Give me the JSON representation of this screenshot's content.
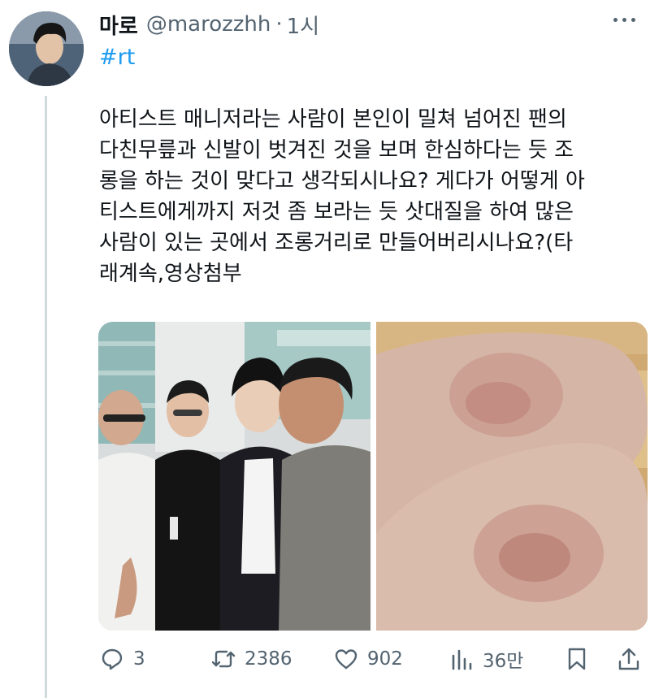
{
  "author": {
    "display_name": "마로",
    "handle": "@marozzhh",
    "separator": "·",
    "time": "1시"
  },
  "hashtag": "#rt",
  "tweet_text": "아티스트 매니저라는 사람이 본인이 밀쳐 넘어진 팬의\n다친무릎과 신발이 벗겨진 것을 보며 한심하다는 듯 조\n롱을 하는 것이 맞다고 생각되시나요? 게다가 어떻게 아\n티스트에게까지 저것 좀 보라는 듯 삿대질을 하여 많은\n사람이 있는 곳에서 조롱거리로 만들어버리시나요?(타\n래계속,영상첨부",
  "media": [
    {
      "icon": "photo-people-airport"
    },
    {
      "icon": "photo-bruised-knees"
    }
  ],
  "actions": {
    "replies": "3",
    "retweets": "2386",
    "likes": "902",
    "views": "36만"
  },
  "colors": {
    "accent": "#1d9bf0",
    "secondary_text": "#536471",
    "primary_text": "#0f1419",
    "thread_line": "#cfd9de"
  }
}
